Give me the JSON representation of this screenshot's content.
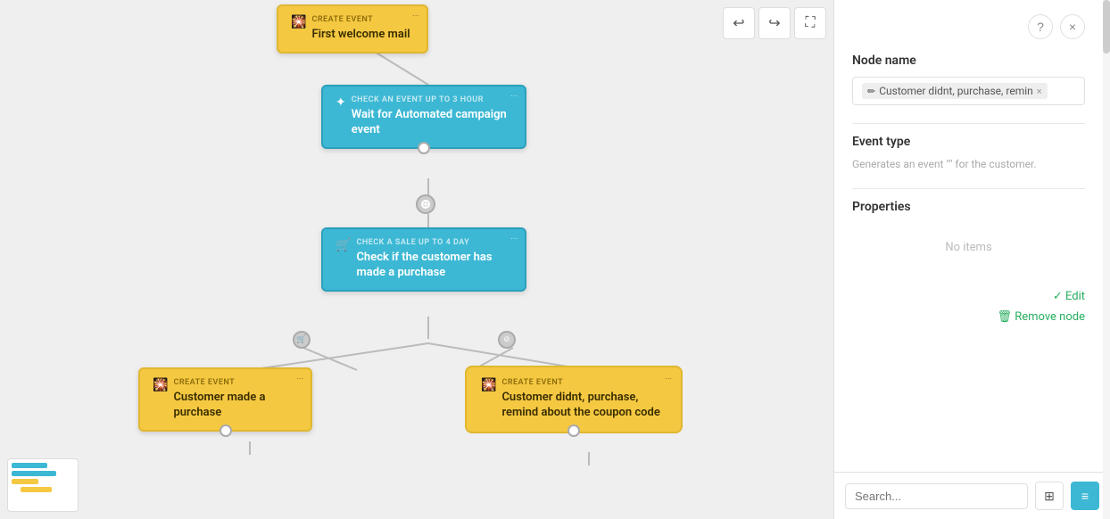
{
  "toolbar": {
    "undo_label": "↩",
    "redo_label": "↪",
    "fullscreen_label": "⛶"
  },
  "nodes": {
    "welcome_mail": {
      "type": "yellow",
      "badge": "CREATE EVENT",
      "title": "First welcome mail",
      "icon": "🎇",
      "menu": "···"
    },
    "check_event": {
      "type": "blue",
      "badge": "CHECK AN EVENT UP TO 3 HOUR",
      "title": "Wait for Automated campaign event",
      "icon": "✦",
      "menu": "···"
    },
    "check_sale": {
      "type": "blue",
      "badge": "CHECK A SALE UP TO 4 DAY",
      "title": "Check if the customer has made a purchase",
      "icon": "🛒",
      "menu": "···"
    },
    "purchase": {
      "type": "yellow",
      "badge": "CREATE EVENT",
      "title": "Customer made a purchase",
      "icon": "🎇",
      "menu": "···"
    },
    "remind": {
      "type": "yellow",
      "badge": "CREATE EVENT",
      "title": "Customer didnt, purchase, remind about the coupon code",
      "icon": "🎇",
      "menu": "···",
      "selected": true
    }
  },
  "panel": {
    "help_icon": "?",
    "close_icon": "×",
    "node_name_label": "Node name",
    "node_name_tag_icon": "✏",
    "node_name_tag_text": "Customer didnt, purchase, remin",
    "node_name_tag_close": "×",
    "event_type_label": "Event type",
    "event_type_desc": "Generates an event \"\" for the customer.",
    "properties_label": "Properties",
    "no_items_text": "No items",
    "edit_label": "✓ Edit",
    "remove_label": "🗑 Remove node"
  },
  "bottom": {
    "search_placeholder": "Search...",
    "search_label": "Search _",
    "grid_icon": "⊞",
    "list_icon": "≡"
  }
}
